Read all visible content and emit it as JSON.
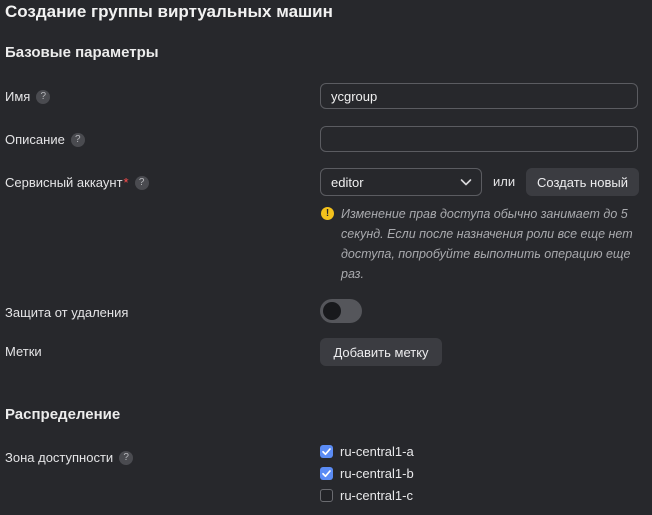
{
  "page_title": "Создание группы виртуальных машин",
  "base_section": {
    "heading": "Базовые параметры",
    "name": {
      "label": "Имя",
      "value": "ycgroup"
    },
    "description": {
      "label": "Описание",
      "value": ""
    },
    "service_account": {
      "label": "Сервисный аккаунт",
      "required_mark": "*",
      "selected": "editor",
      "or_text": "или",
      "create_label": "Создать новый",
      "hint": "Изменение прав доступа обычно занимает до 5 секунд. Если после назначения роли все еще нет доступа, попробуйте выполнить операцию еще раз."
    },
    "deletion_protection": {
      "label": "Защита от удаления",
      "enabled": false
    },
    "labels": {
      "label": "Метки",
      "add_label": "Добавить метку"
    }
  },
  "distribution_section": {
    "heading": "Распределение",
    "zone_label": "Зона доступности",
    "zones": [
      {
        "name": "ru-central1-a",
        "checked": true
      },
      {
        "name": "ru-central1-b",
        "checked": true
      },
      {
        "name": "ru-central1-c",
        "checked": false
      }
    ]
  },
  "help_glyph": "?",
  "colors": {
    "background": "#27282c",
    "accent": "#5b8cf5",
    "warning": "#f3c11c",
    "required": "#ff4d4d"
  }
}
